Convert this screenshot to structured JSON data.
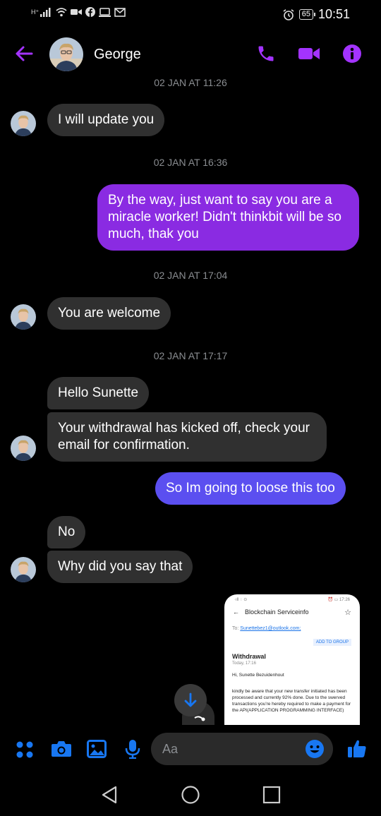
{
  "status_bar": {
    "time": "10:51",
    "battery": "65",
    "signal_text": "H⁺"
  },
  "header": {
    "contact_name": "George",
    "icons": [
      "back-arrow-icon",
      "phone-icon",
      "video-icon",
      "info-icon"
    ]
  },
  "messages": [
    {
      "type": "timestamp",
      "text": "02 JAN AT 11:26"
    },
    {
      "type": "in",
      "text": "I will update you"
    },
    {
      "type": "timestamp",
      "text": "02 JAN AT 16:36"
    },
    {
      "type": "out",
      "text": "By the way, just want to say you are a miracle worker! Didn't thinkbit will be so much, thak you"
    },
    {
      "type": "timestamp",
      "text": "02 JAN AT 17:04"
    },
    {
      "type": "in",
      "text": "You are welcome"
    },
    {
      "type": "timestamp",
      "text": "02 JAN AT 17:17"
    },
    {
      "type": "in",
      "text": "Hello Sunette"
    },
    {
      "type": "in",
      "text": "Your withdrawal has kicked off, check your email for confirmation."
    },
    {
      "type": "out",
      "text": "So Im going to loose this too"
    },
    {
      "type": "in",
      "text": "No"
    },
    {
      "type": "in",
      "text": "Why did you say that"
    }
  ],
  "attachment": {
    "sender": "Blockchain Serviceinfo",
    "to_label": "To:",
    "to_email": "Sunettebez1@outlook.com;",
    "add_to_group": "ADD TO GROUP",
    "subject": "Withdrawal",
    "date": "Today, 17:16",
    "greeting": "Hi, Sunette Bezuidenhout",
    "body": "kindly be aware that your new transfer initiated has been processed and currently 92% done. Due to the swerved transactions you're hereby required to make a payment for the API(APPLICATION PROGRAMMING INTERFACE)"
  },
  "composer": {
    "placeholder": "Aa",
    "icons": [
      "apps-icon",
      "camera-icon",
      "gallery-icon",
      "microphone-icon",
      "emoji-icon",
      "like-icon"
    ]
  },
  "colors": {
    "accent": "#a333ff",
    "outgoing_bubble": "#8a2be2",
    "outgoing_bubble_blue": "#5b4ff0",
    "incoming_bubble": "#303030",
    "composer_blue": "#1877f2"
  }
}
